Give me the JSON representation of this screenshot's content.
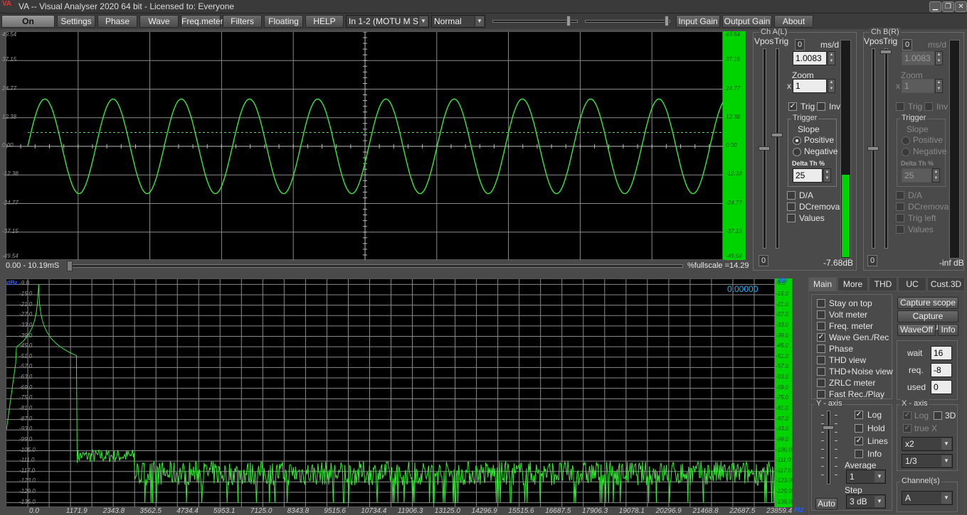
{
  "app": {
    "logo": "VA",
    "title": "VA -- Visual Analyser 2020 64 bit - Licensed to: Everyone"
  },
  "window": {
    "minimize": "▁",
    "restore": "❐",
    "close": "✕"
  },
  "toolbar": {
    "on": "On",
    "settings": "Settings",
    "phase": "Phase",
    "wave": "Wave",
    "freqmeter": "Freq.meter",
    "filters": "Filters",
    "floating": "Floating",
    "help": "HELP",
    "input_device": "In 1-2 (MOTU M Seri",
    "mode": "Normal",
    "input_gain": "Input Gain",
    "output_gain": "Output Gain",
    "about": "About",
    "slider1_value": 0.9,
    "slider2_value": 0.97
  },
  "scope": {
    "y_ticks": [
      "49.54",
      "37.15",
      "24.77",
      "12.38",
      "0.00",
      "-12.38",
      "-24.77",
      "-37.15",
      "-49.54"
    ],
    "time_range": "0.00 - 10.19mS",
    "fullscale": "%fullscale =14.29",
    "amplitude": 20.5,
    "trigger_level": 6.0,
    "cycles": 10.2,
    "colors": {
      "trace": "#38e838",
      "grid": "#8a8a8a"
    }
  },
  "chA": {
    "caption": "Ch A(L)",
    "vpos": "Vpos",
    "trig": "Trig",
    "ms_box": "0",
    "ms_unit": "ms/d",
    "ms_value": "1.0083",
    "zoom_label": "Zoom",
    "zoom_x": "x",
    "zoom_value": "1",
    "trig_check": "Trig",
    "inv_check": "Inv",
    "trigger_caption": "Trigger",
    "slope": "Slope",
    "positive": "Positive",
    "negative": "Negative",
    "delta_th": "Delta Th %",
    "delta_value": "25",
    "da": "D/A",
    "dcremoval": "DCremoval",
    "values": "Values",
    "vpos_box": "0",
    "level": "-7.68dB",
    "meter_fill": 0.38,
    "checks": {
      "check_trig": "✓"
    }
  },
  "chB": {
    "caption": "Ch B(R)",
    "vpos": "Vpos",
    "trig": "Trig",
    "ms_box": "0",
    "ms_unit": "ms/d",
    "ms_value": "1.0083",
    "zoom_label": "Zoom",
    "zoom_x": "x",
    "zoom_value": "1",
    "trig_check": "Trig",
    "inv_check": "Inv",
    "trigger_caption": "Trigger",
    "slope": "Slope",
    "positive": "Positive",
    "negative": "Negative",
    "delta_th": "Delta Th %",
    "delta_value": "25",
    "da": "D/A",
    "dcremoval": "DCremoval",
    "trig_left": "Trig left",
    "values": "Values",
    "vpos_box": "0",
    "level": "-inf dB"
  },
  "spectrum": {
    "unit": "dBr",
    "y_ticks": [
      "-9.0",
      "-15.0",
      "-21.0",
      "-27.0",
      "-33.0",
      "-39.0",
      "-45.0",
      "-51.0",
      "-57.0",
      "-63.0",
      "-69.0",
      "-75.0",
      "-81.0",
      "-87.0",
      "-93.0",
      "-99.0",
      "-105.0",
      "-111.0",
      "-117.0",
      "-123.0",
      "-129.0",
      "-135.0"
    ],
    "x_ticks": [
      "0.0",
      "1171.9",
      "2343.8",
      "3562.5",
      "4734.4",
      "5953.1",
      "7125.0",
      "8343.8",
      "9515.6",
      "10734.4",
      "11906.3",
      "13125.0",
      "14296.9",
      "15515.6",
      "16687.5",
      "17906.3",
      "19078.1",
      "20296.9",
      "21468.8",
      "22687.5",
      "23859.4"
    ],
    "hz": "Hz",
    "readout": "0.00000",
    "colors": {
      "trace": "#38e838",
      "grid": "#8a8a8a",
      "readout": "#22b8ff",
      "unit": "#1f5cff"
    }
  },
  "tabs": [
    "Main",
    "More",
    "THD",
    "UC",
    "Cust.3D"
  ],
  "main": {
    "stay_on_top": "Stay on top",
    "volt_meter": "Volt meter",
    "freq_meter": "Freq. meter",
    "wave_gen": "Wave Gen./Rec",
    "phase": "Phase",
    "thd_view": "THD view",
    "thd_noise_view": "THD+Noise view",
    "zrlc_meter": "ZRLC meter",
    "fast_rec": "Fast Rec./Play",
    "capture_scope": "Capture scope",
    "capture_spectrum": "Capture spectrum",
    "waveoff": "WaveOff",
    "info": "Info",
    "wait_label": "wait",
    "wait_value": "16",
    "req_label": "req.",
    "req_value": "-8",
    "used_label": "used",
    "used_value": "0",
    "checks": {
      "wave_gen": "✓",
      "log": "✓",
      "lines": "✓",
      "x_log": "✓",
      "x_truex": "✓"
    }
  },
  "yaxis": {
    "caption": "Y - axis",
    "log": "Log",
    "hold": "Hold",
    "lines": "Lines",
    "info": "Info",
    "average_label": "Average",
    "average_value": "1",
    "step_label": "Step",
    "step_value": "3 dB",
    "auto": "Auto"
  },
  "xaxis": {
    "caption": "X - axis",
    "log": "Log",
    "threed": "3D",
    "truex": "true X",
    "scale": "x2",
    "fraction": "1/3"
  },
  "channels": {
    "caption": "Channel(s)",
    "value": "A"
  }
}
